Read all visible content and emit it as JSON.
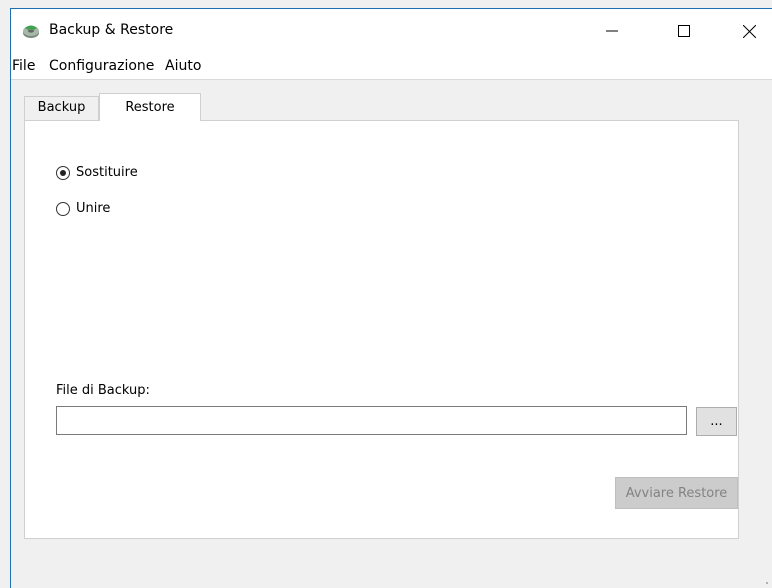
{
  "window": {
    "title": "Backup & Restore",
    "icon": "backup-drive-icon"
  },
  "window_controls": {
    "minimize_icon": "minimize-icon",
    "maximize_icon": "maximize-icon",
    "close_icon": "close-icon"
  },
  "menu": {
    "items": [
      {
        "label": "File"
      },
      {
        "label": "Configurazione"
      },
      {
        "label": "Aiuto"
      }
    ]
  },
  "tabs": [
    {
      "label": "Backup",
      "active": false
    },
    {
      "label": "Restore",
      "active": true
    }
  ],
  "restore_panel": {
    "mode_options": [
      {
        "label": "Sostituire",
        "checked": true
      },
      {
        "label": "Unire",
        "checked": false
      }
    ],
    "backup_file_label": "File di Backup:",
    "backup_file_value": "",
    "browse_label": "...",
    "start_button_label": "Avviare Restore",
    "start_button_enabled": false
  },
  "colors": {
    "window_border": "#1f6fb5",
    "disabled_button_bg": "#cccccc",
    "disabled_button_text": "#838383"
  }
}
